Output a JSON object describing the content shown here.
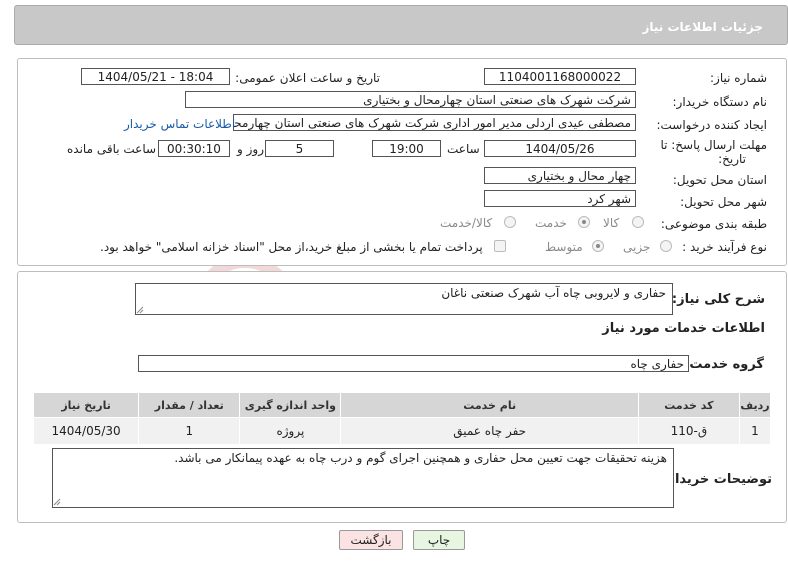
{
  "header": {
    "title": "جزئیات اطلاعات نیاز"
  },
  "form": {
    "need_number_label": "شماره نیاز:",
    "need_number": "1104001168000022",
    "announce_label": "تاریخ و ساعت اعلان عمومی:",
    "announce_value": "1404/05/21 - 18:04",
    "buyer_label": "نام دستگاه خریدار:",
    "buyer_value": "شرکت شهرک های صنعتی استان چهارمحال و بختیاری",
    "creator_label": "ایجاد کننده درخواست:",
    "creator_value": "مصطفی عیدی اردلی مدیر امور اداری شرکت شهرک های صنعتی استان چهارمحال و بختیاری",
    "contact_link": "اطلاعات تماس خریدار",
    "deadline_label_line1": "مهلت ارسال پاسخ: تا",
    "deadline_label_line2": "تاریخ:",
    "deadline_date": "1404/05/26",
    "hour_label": "ساعت",
    "deadline_time": "19:00",
    "days_value": "5",
    "days_label": "روز و",
    "remaining_time": "00:30:10",
    "remaining_label": "ساعت باقی مانده",
    "province_label": "استان محل تحویل:",
    "province_value": "چهار محال و بختیاری",
    "city_label": "شهر محل تحویل:",
    "city_value": "شهر کرد",
    "category_label": "طبقه بندی موضوعی:",
    "category_options": [
      "کالا",
      "خدمت",
      "کالا/خدمت"
    ],
    "category_selected": "خدمت",
    "process_label": "نوع فرآیند خرید :",
    "process_options": [
      "جزیی",
      "متوسط"
    ],
    "process_selected": "متوسط",
    "payment_note": "پرداخت تمام یا بخشی از مبلغ خرید،از محل \"اسناد خزانه اسلامی\" خواهد بود."
  },
  "summary": {
    "label": "شرح کلی نیاز:",
    "value": "حفاری و لایروبی چاه آب شهرک صنعتی ناغان"
  },
  "services": {
    "heading": "اطلاعات خدمات مورد نیاز",
    "group_label": "گروه خدمت:",
    "group_value": "حفاری چاه",
    "columns": [
      "ردیف",
      "کد خدمت",
      "نام خدمت",
      "واحد اندازه گیری",
      "تعداد / مقدار",
      "تاریخ نیاز"
    ],
    "rows": [
      {
        "index": "1",
        "code": "ق-110",
        "name": "حفر چاه عمیق",
        "unit": "پروژه",
        "qty": "1",
        "date": "1404/05/30"
      }
    ]
  },
  "buyer_notes": {
    "label": "توضیحات خریدار:",
    "value": "هزینه تحقیقات جهت تعیین محل حفاری و همچنین اجرای گوم و درب چاه به عهده پیمانکار می باشد."
  },
  "buttons": {
    "print": "چاپ",
    "back": "بازگشت"
  },
  "watermark": {
    "text": "AriaTender.neT"
  },
  "colors": {
    "header_bg": "#c8c8c8",
    "link": "#1a5aa8",
    "back_button_bg": "#fbe3e3",
    "print_button_bg": "#e6f6e0",
    "watermark": "#e9c9c9"
  }
}
